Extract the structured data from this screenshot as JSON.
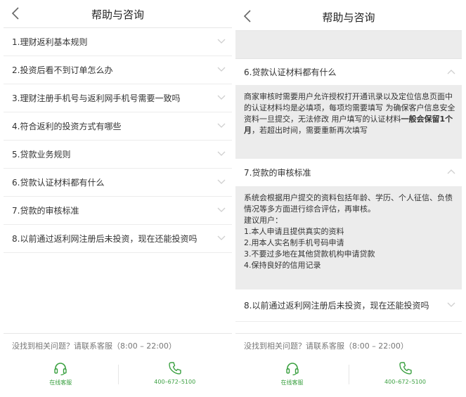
{
  "title": "帮助与咨询",
  "left": {
    "items": [
      "1.理财返利基本规则",
      "2.投资后看不到订单怎么办",
      "3.理财注册手机号与返利网手机号需要一致吗",
      "4.符合返利的投资方式有哪些",
      "5.贷款业务规则",
      "6.贷款认证材料都有什么",
      "7.贷款的审核标准",
      "8.以前通过返利网注册后未投资，现在还能投资吗"
    ]
  },
  "right": {
    "q6": "6.贷款认证材料都有什么",
    "a6": {
      "line1": "商家审核时需要用户允许授权打开通讯录以及定位信息页面中的认证材料均是必填项，每项均需要填写 为确保客户信息安全",
      "line2_pre": "资料一旦提交，无法修改 用户填写的认证材料",
      "line2_bold": "一般会保留1个月",
      "line2_post": "，若超出时间，需要重新再次填写"
    },
    "q7": "7.贷款的审核标准",
    "a7": {
      "intro": "系统会根据用户提交的资料包括年龄、学历、个人征信、负债情况等多方面进行综合评估，再审核。",
      "advice": "建议用户：",
      "tips": [
        "1.本人申请且提供真实的资料",
        "2.用本人实名制手机号码申请",
        "3.不要过多地在其他贷款机构申请贷款",
        "4.保持良好的信用记录"
      ]
    },
    "q8": "8.以前通过返利网注册后未投资，现在还能投资吗"
  },
  "footer": {
    "note": "没找到相关问题？请联系客服（8:00 – 22:00）",
    "online_label": "在线客服",
    "phone_label": "400–672–5100"
  },
  "colors": {
    "accent": "#3aa040",
    "answer_bg": "#ececec"
  },
  "icons": {
    "back": "chevron-left-icon",
    "collapse": "chevron-down-icon",
    "expand": "chevron-up-icon",
    "service": "headset-icon",
    "phone": "phone-icon"
  }
}
